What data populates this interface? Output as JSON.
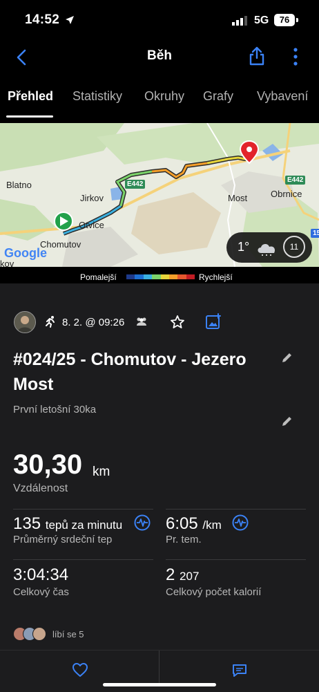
{
  "status": {
    "time": "14:52",
    "network": "5G",
    "battery": "76"
  },
  "nav": {
    "title": "Běh"
  },
  "tabs": [
    "Přehled",
    "Statistiky",
    "Okruhy",
    "Grafy",
    "Vybavení"
  ],
  "map": {
    "labels": {
      "blatno": "Blatno",
      "jirkov": "Jirkov",
      "otvice": "Otvice",
      "chomutov": "Chomutov",
      "most": "Most",
      "obrnice": "Obrnice",
      "kov": "kov",
      "e442a": "E442",
      "e442b": "E442",
      "road15": "15"
    },
    "google": "Google",
    "weather": {
      "temp": "1°",
      "wind": "11"
    }
  },
  "legend": {
    "slower": "Pomalejší",
    "faster": "Rychlejší",
    "colors": [
      "#1e3a8a",
      "#1d6fd1",
      "#3ab0e0",
      "#7bd36a",
      "#e7d53a",
      "#f59f2a",
      "#e4572e",
      "#c21d24"
    ]
  },
  "activity": {
    "date": "8. 2. @ 09:26",
    "title": "#024/25 - Chomutov - Jezero Most",
    "description": "První letošní 30ka",
    "distance": {
      "value": "30,30",
      "unit": "km",
      "label": "Vzdálenost"
    },
    "stats": {
      "hr": {
        "value": "135",
        "unit": "tepů za minutu",
        "label": "Průměrný srdeční tep"
      },
      "pace": {
        "value": "6:05",
        "unit": "/km",
        "label": "Pr. tem."
      },
      "time": {
        "value": "3:04:34",
        "label": "Celkový čas"
      },
      "calories": {
        "value": "2",
        "unit": "207",
        "label": "Celkový počet kalorií"
      }
    },
    "likes": "líbí se 5"
  },
  "colors": {
    "accent": "#3b82f6",
    "background": "#000000",
    "card": "#1c1c1e"
  }
}
